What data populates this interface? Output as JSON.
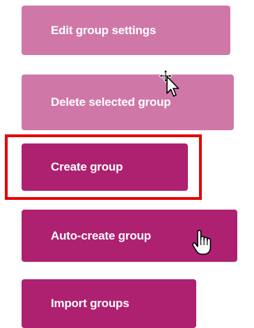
{
  "buttons": {
    "edit_group_settings": "Edit group settings",
    "delete_selected_group": "Delete selected group",
    "create_group": "Create group",
    "auto_create_group": "Auto-create group",
    "import_groups": "Import groups"
  },
  "colors": {
    "disabled_button": "#cf78a8",
    "active_button": "#ad2170",
    "highlight_border": "#e60000",
    "button_text": "#ffffff"
  },
  "icons": {
    "move_cursor": "move-cursor-icon",
    "hand_cursor": "hand-pointer-icon"
  }
}
